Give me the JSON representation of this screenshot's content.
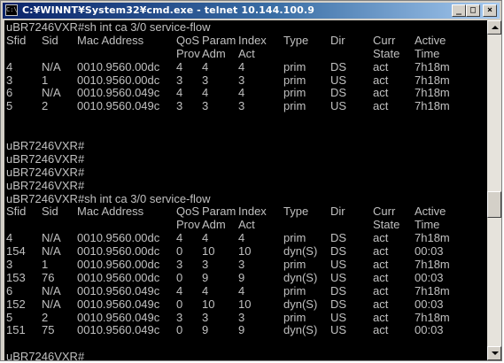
{
  "window": {
    "title": "C:¥WINNT¥System32¥cmd.exe - telnet 10.144.100.9",
    "icon": "console-app-icon",
    "controls": {
      "minimize": "_",
      "maximize": "□",
      "close": "×"
    }
  },
  "console": {
    "lines": [
      [
        "uBR7246VXR#sh int ca 3/0 service-flow"
      ],
      [
        "Sfid",
        "Sid",
        "Mac Address",
        "QoS",
        "Param",
        "Index",
        "Type",
        "Dir",
        "Curr",
        "Active"
      ],
      [
        "",
        "",
        "",
        "Prov",
        "Adm",
        "Act",
        "",
        "",
        "State",
        "Time"
      ],
      [
        "4",
        "N/A",
        "0010.9560.00dc",
        "4",
        "4",
        "4",
        "prim",
        "DS",
        "act",
        "7h18m"
      ],
      [
        "3",
        "1",
        "0010.9560.00dc",
        "3",
        "3",
        "3",
        "prim",
        "US",
        "act",
        "7h18m"
      ],
      [
        "6",
        "N/A",
        "0010.9560.049c",
        "4",
        "4",
        "4",
        "prim",
        "DS",
        "act",
        "7h18m"
      ],
      [
        "5",
        "2",
        "0010.9560.049c",
        "3",
        "3",
        "3",
        "prim",
        "US",
        "act",
        "7h18m"
      ],
      [
        ""
      ],
      [
        ""
      ],
      [
        "uBR7246VXR#"
      ],
      [
        "uBR7246VXR#"
      ],
      [
        "uBR7246VXR#"
      ],
      [
        "uBR7246VXR#"
      ],
      [
        "uBR7246VXR#sh int ca 3/0 service-flow"
      ],
      [
        "Sfid",
        "Sid",
        "Mac Address",
        "QoS",
        "Param",
        "Index",
        "Type",
        "Dir",
        "Curr",
        "Active"
      ],
      [
        "",
        "",
        "",
        "Prov",
        "Adm",
        "Act",
        "",
        "",
        "State",
        "Time"
      ],
      [
        "4",
        "N/A",
        "0010.9560.00dc",
        "4",
        "4",
        "4",
        "prim",
        "DS",
        "act",
        "7h18m"
      ],
      [
        "154",
        "N/A",
        "0010.9560.00dc",
        "0",
        "10",
        "10",
        "dyn(S)",
        "DS",
        "act",
        "00:03"
      ],
      [
        "3",
        "1",
        "0010.9560.00dc",
        "3",
        "3",
        "3",
        "prim",
        "US",
        "act",
        "7h18m"
      ],
      [
        "153",
        "76",
        "0010.9560.00dc",
        "0",
        "9",
        "9",
        "dyn(S)",
        "US",
        "act",
        "00:03"
      ],
      [
        "6",
        "N/A",
        "0010.9560.049c",
        "4",
        "4",
        "4",
        "prim",
        "DS",
        "act",
        "7h18m"
      ],
      [
        "152",
        "N/A",
        "0010.9560.049c",
        "0",
        "10",
        "10",
        "dyn(S)",
        "DS",
        "act",
        "00:03"
      ],
      [
        "5",
        "2",
        "0010.9560.049c",
        "3",
        "3",
        "3",
        "prim",
        "US",
        "act",
        "7h18m"
      ],
      [
        "151",
        "75",
        "0010.9560.049c",
        "0",
        "9",
        "9",
        "dyn(S)",
        "US",
        "act",
        "00:03"
      ],
      [
        ""
      ],
      [
        "uBR7246VXR#"
      ]
    ]
  }
}
